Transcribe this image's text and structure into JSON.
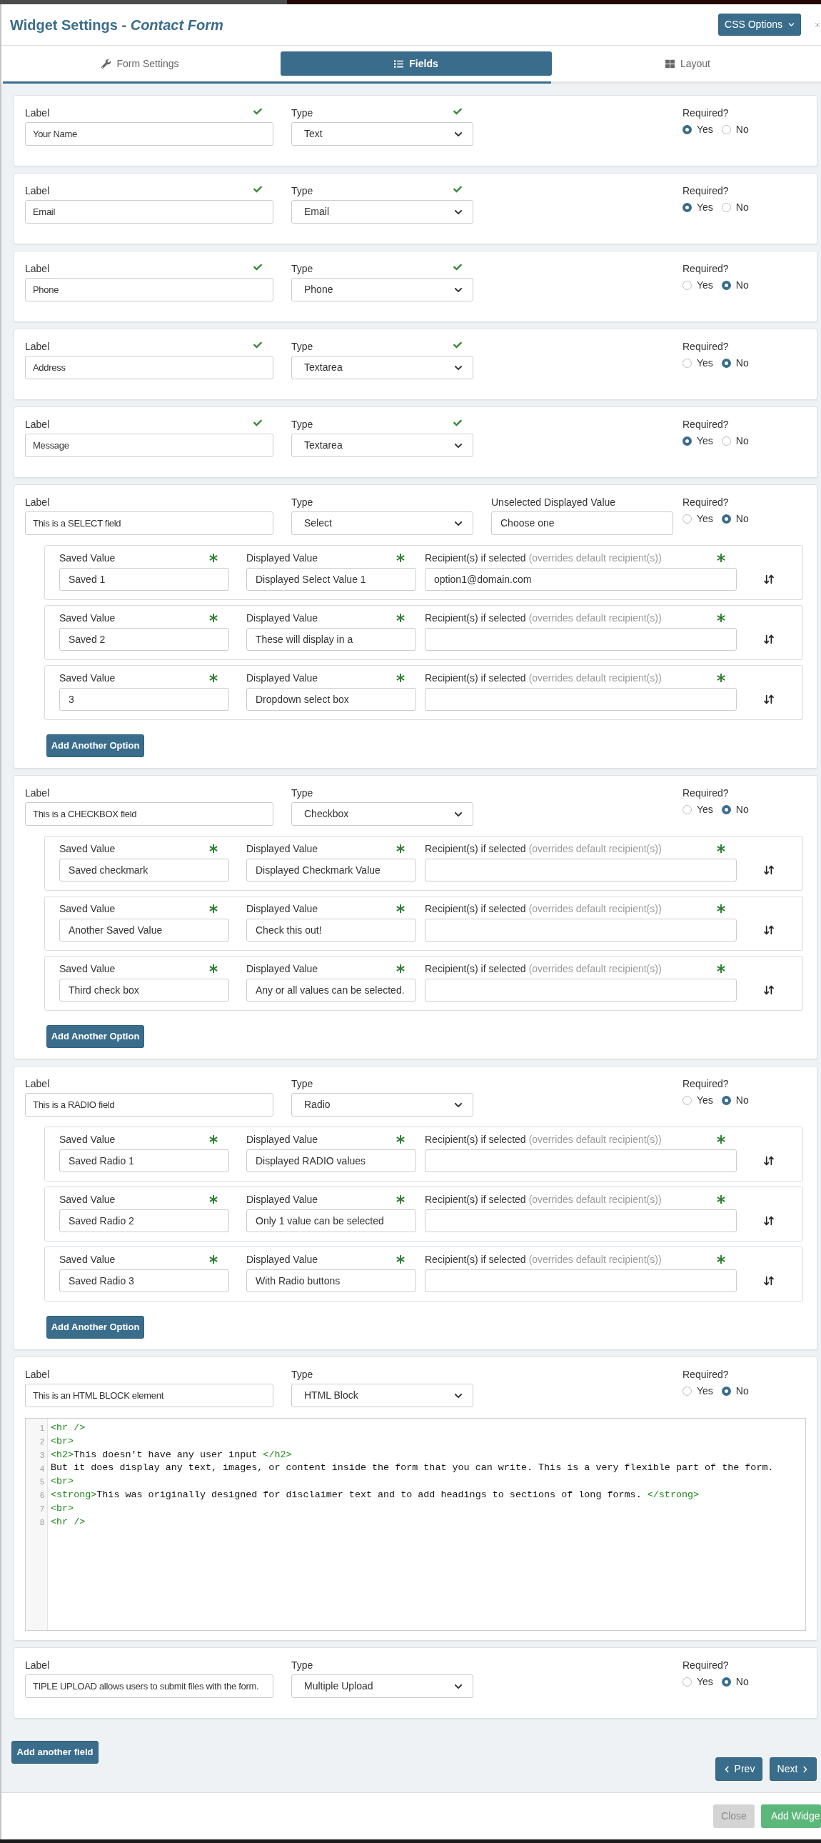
{
  "header": {
    "title": "Widget Settings - *Contact Form*",
    "css_button": "CSS Options"
  },
  "tabs": [
    {
      "label": "Form Settings",
      "selected": false
    },
    {
      "label": "Fields",
      "selected": true
    },
    {
      "label": "Layout",
      "selected": false
    }
  ],
  "progress": {
    "level": 0.67
  },
  "fields": [
    {
      "label": {
        "caption": "Label",
        "value": "Your Name"
      },
      "type": {
        "caption": "Type",
        "value": "Text"
      },
      "validated": true,
      "required": {
        "caption": "Required?",
        "options": [
          {
            "label": "Yes",
            "selected": true
          },
          {
            "label": "No",
            "selected": false
          }
        ]
      }
    },
    {
      "label": {
        "caption": "Label",
        "value": "Email"
      },
      "type": {
        "caption": "Type",
        "value": "Email"
      },
      "validated": true,
      "required": {
        "caption": "Required?",
        "options": [
          {
            "label": "Yes",
            "selected": true
          },
          {
            "label": "No",
            "selected": false
          }
        ]
      }
    },
    {
      "label": {
        "caption": "Label",
        "value": "Phone"
      },
      "type": {
        "caption": "Type",
        "value": "Phone"
      },
      "validated": true,
      "required": {
        "caption": "Required?",
        "options": [
          {
            "label": "Yes",
            "selected": false
          },
          {
            "label": "No",
            "selected": true
          }
        ]
      }
    },
    {
      "label": {
        "caption": "Label",
        "value": "Address"
      },
      "type": {
        "caption": "Type",
        "value": "Textarea"
      },
      "validated": true,
      "required": {
        "caption": "Required?",
        "options": [
          {
            "label": "Yes",
            "selected": false
          },
          {
            "label": "No",
            "selected": true
          }
        ]
      }
    },
    {
      "label": {
        "caption": "Label",
        "value": "Message"
      },
      "type": {
        "caption": "Type",
        "value": "Textarea"
      },
      "validated": true,
      "required": {
        "caption": "Required?",
        "options": [
          {
            "label": "Yes",
            "selected": true
          },
          {
            "label": "No",
            "selected": false
          }
        ]
      }
    },
    {
      "label": {
        "caption": "Label",
        "value": "This is a SELECT field"
      },
      "type": {
        "caption": "Type",
        "value": "Select"
      },
      "validated": false,
      "unselected": {
        "caption": "Unselected Displayed Value",
        "value": "Choose one"
      },
      "required": {
        "caption": "Required?",
        "options": [
          {
            "label": "Yes",
            "selected": false
          },
          {
            "label": "No",
            "selected": true
          }
        ]
      },
      "options": [
        {
          "saved": {
            "caption": "Saved Value",
            "value": "Saved 1"
          },
          "displayed": {
            "caption": "Displayed Value",
            "value": "Displayed Select Value 1"
          },
          "recipient": {
            "caption": "Recipient(s) if selected",
            "note": "(overrides default recipient(s))",
            "value": "option1@domain.com"
          }
        },
        {
          "saved": {
            "caption": "Saved Value",
            "value": "Saved 2"
          },
          "displayed": {
            "caption": "Displayed Value",
            "value": "These will display in a"
          },
          "recipient": {
            "caption": "Recipient(s) if selected",
            "note": "(overrides default recipient(s))"
          }
        },
        {
          "saved": {
            "caption": "Saved Value",
            "value": "3"
          },
          "displayed": {
            "caption": "Displayed Value",
            "value": "Dropdown select box"
          },
          "recipient": {
            "caption": "Recipient(s) if selected",
            "note": "(overrides default recipient(s))"
          }
        }
      ],
      "add_option_button": "Add Another Option"
    },
    {
      "label": {
        "caption": "Label",
        "value": "This is a CHECKBOX field"
      },
      "type": {
        "caption": "Type",
        "value": "Checkbox"
      },
      "validated": false,
      "required": {
        "caption": "Required?",
        "options": [
          {
            "label": "Yes",
            "selected": false
          },
          {
            "label": "No",
            "selected": true
          }
        ]
      },
      "options": [
        {
          "saved": {
            "caption": "Saved Value",
            "value": "Saved checkmark"
          },
          "displayed": {
            "caption": "Displayed Value",
            "value": "Displayed Checkmark Value"
          },
          "recipient": {
            "caption": "Recipient(s) if selected",
            "note": "(overrides default recipient(s))"
          }
        },
        {
          "saved": {
            "caption": "Saved Value",
            "value": "Another Saved Value"
          },
          "displayed": {
            "caption": "Displayed Value",
            "value": "Check this out!"
          },
          "recipient": {
            "caption": "Recipient(s) if selected",
            "note": "(overrides default recipient(s))"
          }
        },
        {
          "saved": {
            "caption": "Saved Value",
            "value": "Third check box"
          },
          "displayed": {
            "caption": "Displayed Value",
            "value": "Any or all values can be selected."
          },
          "recipient": {
            "caption": "Recipient(s) if selected",
            "note": "(overrides default recipient(s))"
          }
        }
      ],
      "add_option_button": "Add Another Option"
    },
    {
      "label": {
        "caption": "Label",
        "value": "This is a RADIO field"
      },
      "type": {
        "caption": "Type",
        "value": "Radio"
      },
      "validated": false,
      "required": {
        "caption": "Required?",
        "options": [
          {
            "label": "Yes",
            "selected": false
          },
          {
            "label": "No",
            "selected": true
          }
        ]
      },
      "options": [
        {
          "saved": {
            "caption": "Saved Value",
            "value": "Saved Radio 1"
          },
          "displayed": {
            "caption": "Displayed Value",
            "value": "Displayed RADIO values"
          },
          "recipient": {
            "caption": "Recipient(s) if selected",
            "note": "(overrides default recipient(s))"
          }
        },
        {
          "saved": {
            "caption": "Saved Value",
            "value": "Saved Radio 2"
          },
          "displayed": {
            "caption": "Displayed Value",
            "value": "Only 1 value can be selected"
          },
          "recipient": {
            "caption": "Recipient(s) if selected",
            "note": "(overrides default recipient(s))"
          }
        },
        {
          "saved": {
            "caption": "Saved Value",
            "value": "Saved Radio 3"
          },
          "displayed": {
            "caption": "Displayed Value",
            "value": "With Radio buttons"
          },
          "recipient": {
            "caption": "Recipient(s) if selected",
            "note": "(overrides default recipient(s))"
          }
        }
      ],
      "add_option_button": "Add Another Option"
    },
    {
      "label": {
        "caption": "Label",
        "value": "This is an HTML BLOCK element"
      },
      "type": {
        "caption": "Type",
        "value": "HTML Block"
      },
      "validated": false,
      "required": {
        "caption": "Required?",
        "options": [
          {
            "label": "Yes",
            "selected": false
          },
          {
            "label": "No",
            "selected": true
          }
        ]
      },
      "code": [
        {
          "number": "1",
          "tokens": [
            {
              "kind": "tag",
              "text": "<hr />"
            }
          ]
        },
        {
          "number": "2",
          "tokens": [
            {
              "kind": "tag",
              "text": "<br>"
            }
          ]
        },
        {
          "number": "3",
          "tokens": [
            {
              "kind": "tag",
              "text": "<h2>"
            },
            {
              "kind": "text",
              "text": "This doesn't have any user input "
            },
            {
              "kind": "tag",
              "text": "</h2>"
            }
          ]
        },
        {
          "number": "4",
          "tokens": [
            {
              "kind": "text",
              "text": "But it does display any text, images, or content inside the form that you can write. This is a very flexible part of the form."
            }
          ]
        },
        {
          "number": "5",
          "tokens": [
            {
              "kind": "tag",
              "text": "<br>"
            }
          ]
        },
        {
          "number": "6",
          "tokens": [
            {
              "kind": "tag",
              "text": "<strong>"
            },
            {
              "kind": "text",
              "text": "This was originally designed for disclaimer text and to add headings to sections of long forms. "
            },
            {
              "kind": "tag",
              "text": "</strong>"
            }
          ]
        },
        {
          "number": "7",
          "tokens": [
            {
              "kind": "tag",
              "text": "<br>"
            }
          ]
        },
        {
          "number": "8",
          "tokens": [
            {
              "kind": "tag",
              "text": "<hr />"
            }
          ]
        }
      ]
    },
    {
      "label": {
        "caption": "Label",
        "value": "TIPLE UPLOAD allows users to submit files with the form."
      },
      "type": {
        "caption": "Type",
        "value": "Multiple Upload"
      },
      "validated": false,
      "required": {
        "caption": "Required?",
        "options": [
          {
            "label": "Yes",
            "selected": false
          },
          {
            "label": "No",
            "selected": true
          }
        ]
      }
    }
  ],
  "add_field_button": "Add another field",
  "nav_buttons": [
    {
      "label": "Prev",
      "kind": "prev"
    },
    {
      "label": "Next",
      "kind": "next"
    }
  ],
  "footer_buttons": [
    {
      "label": "Close",
      "kind": "secondary"
    },
    {
      "label": "Add Widge",
      "kind": "success"
    }
  ]
}
